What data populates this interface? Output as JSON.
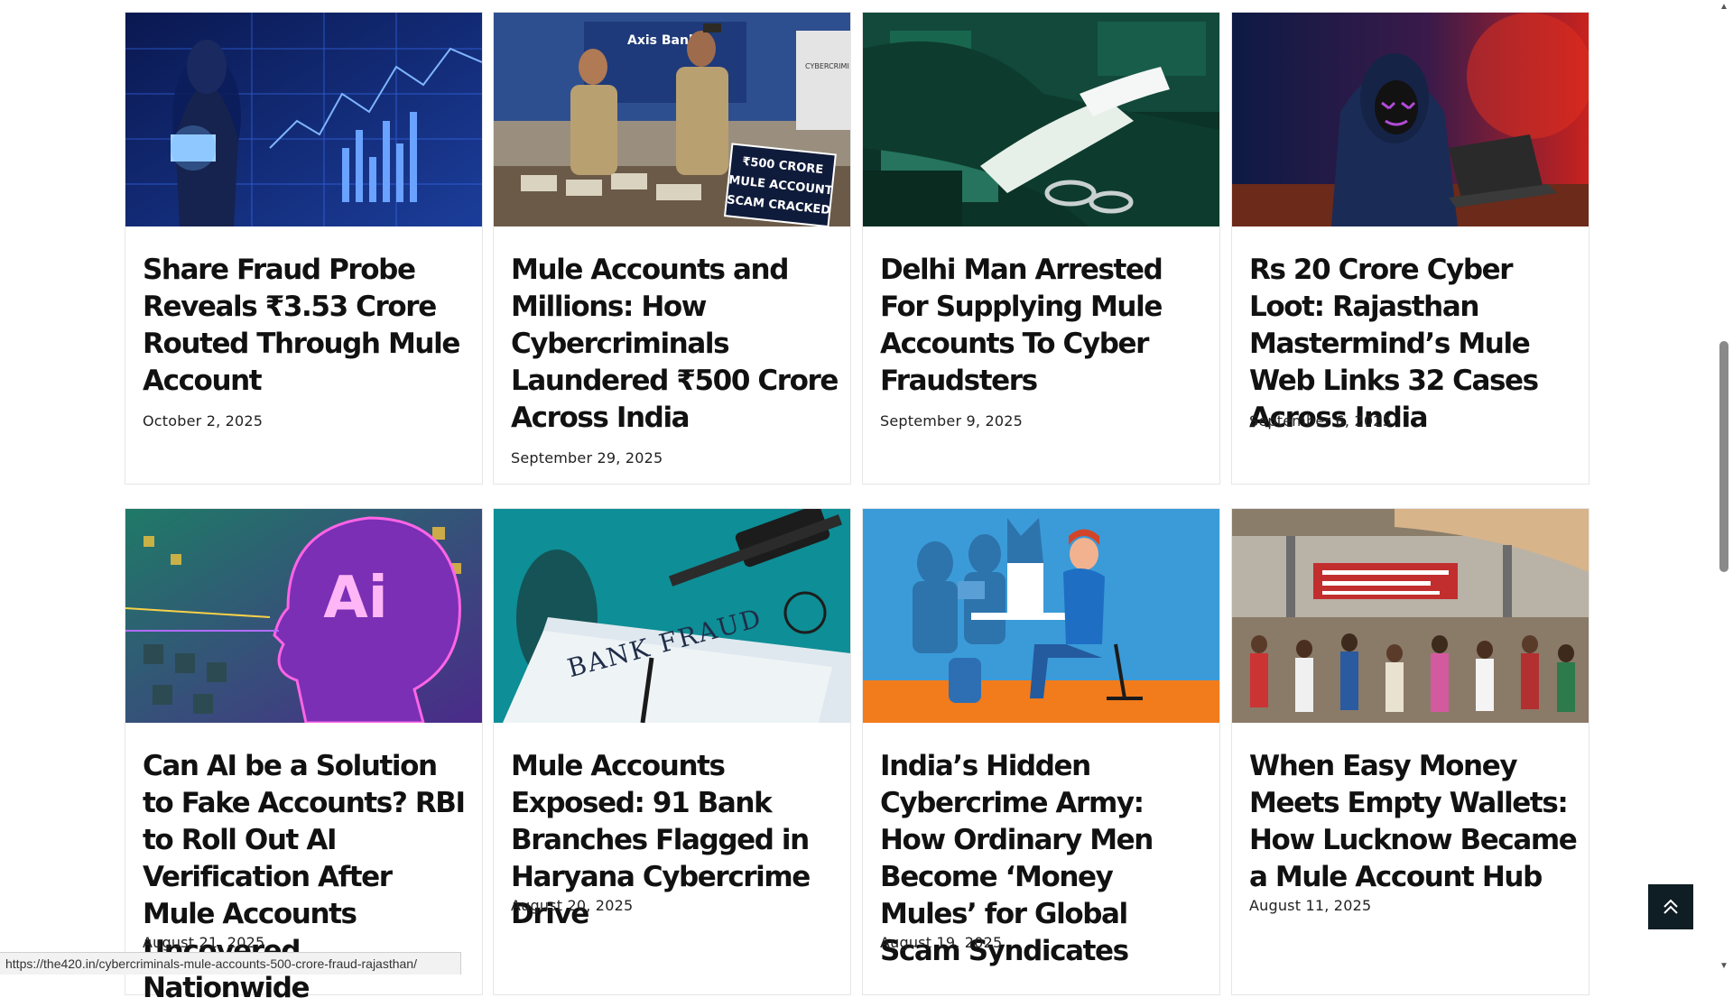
{
  "articles": [
    {
      "title": "Share Fraud Probe Reveals ₹3.53 Crore Routed Through Mule Account",
      "date": "October 2, 2025",
      "image": "hacker-laptop-data-image"
    },
    {
      "title": "Mule Accounts and Millions: How Cybercriminals Laundered ₹500 Crore Across India",
      "date": "September 29, 2025",
      "image": "police-mule-scam-image",
      "image_text": {
        "bank": "Axis Bank",
        "sign": [
          "₹500 CRORE",
          "MULE ACCOUNT",
          "SCAM CRACKED"
        ],
        "panel": "CYBERCRIMI BUSTED"
      }
    },
    {
      "title": "Delhi Man Arrested For Supplying Mule Accounts To Cyber Fraudsters",
      "date": "September 9, 2025",
      "image": "handcuffs-arrest-image"
    },
    {
      "title": "Rs 20 Crore Cyber Loot: Rajasthan Mastermind’s Mule Web Links 32 Cases Across India",
      "date": "September 6, 2025",
      "image": "masked-hacker-image"
    },
    {
      "title": "Can AI be a Solution to Fake Accounts? RBI to Roll Out AI Verification After Mule Accounts Uncovered Nationwide",
      "date": "August 21, 2025",
      "image": "ai-head-circuit-image",
      "image_text": "Ai"
    },
    {
      "title": "Mule Accounts Exposed: 91 Bank Branches Flagged in Haryana Cybercrime Drive",
      "date": "August 20, 2025",
      "image": "bank-fraud-gavel-image",
      "image_text": "BANK FRAUD"
    },
    {
      "title": "India’s Hidden Cybercrime Army: How Ordinary Men Become ‘Money Mules’ for Global Scam Syndicates",
      "date": "August 19, 2025",
      "image": "money-mule-illustration-image"
    },
    {
      "title": "When Easy Money Meets Empty Wallets: How Lucknow Became a Mule Account Hub",
      "date": "August 11, 2025",
      "image": "crowded-station-image"
    }
  ],
  "status_bar": {
    "url": "https://the420.in/cybercriminals-mule-accounts-500-crore-fraud-rajasthan/"
  },
  "back_to_top": {
    "icon": "double-chevron-up-icon"
  },
  "scrollbar": {
    "up_icon": "arrow-up-icon",
    "down_icon": "arrow-down-icon"
  }
}
